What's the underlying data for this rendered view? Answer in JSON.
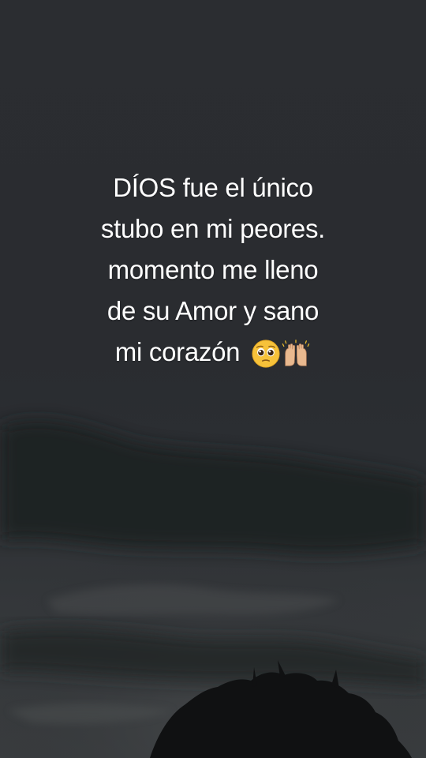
{
  "quote": {
    "lines": [
      "DÍOS  fue el único",
      "stubo en mi peores.",
      "momento me lleno",
      "de su Amor y sano",
      "mi corazón"
    ],
    "emojis": [
      "pleading-face-icon",
      "raising-hands-icon"
    ]
  },
  "colors": {
    "text": "#ffffff",
    "sky": "#2b2d31",
    "clouds": "#232528",
    "tree": "#0f1011"
  }
}
